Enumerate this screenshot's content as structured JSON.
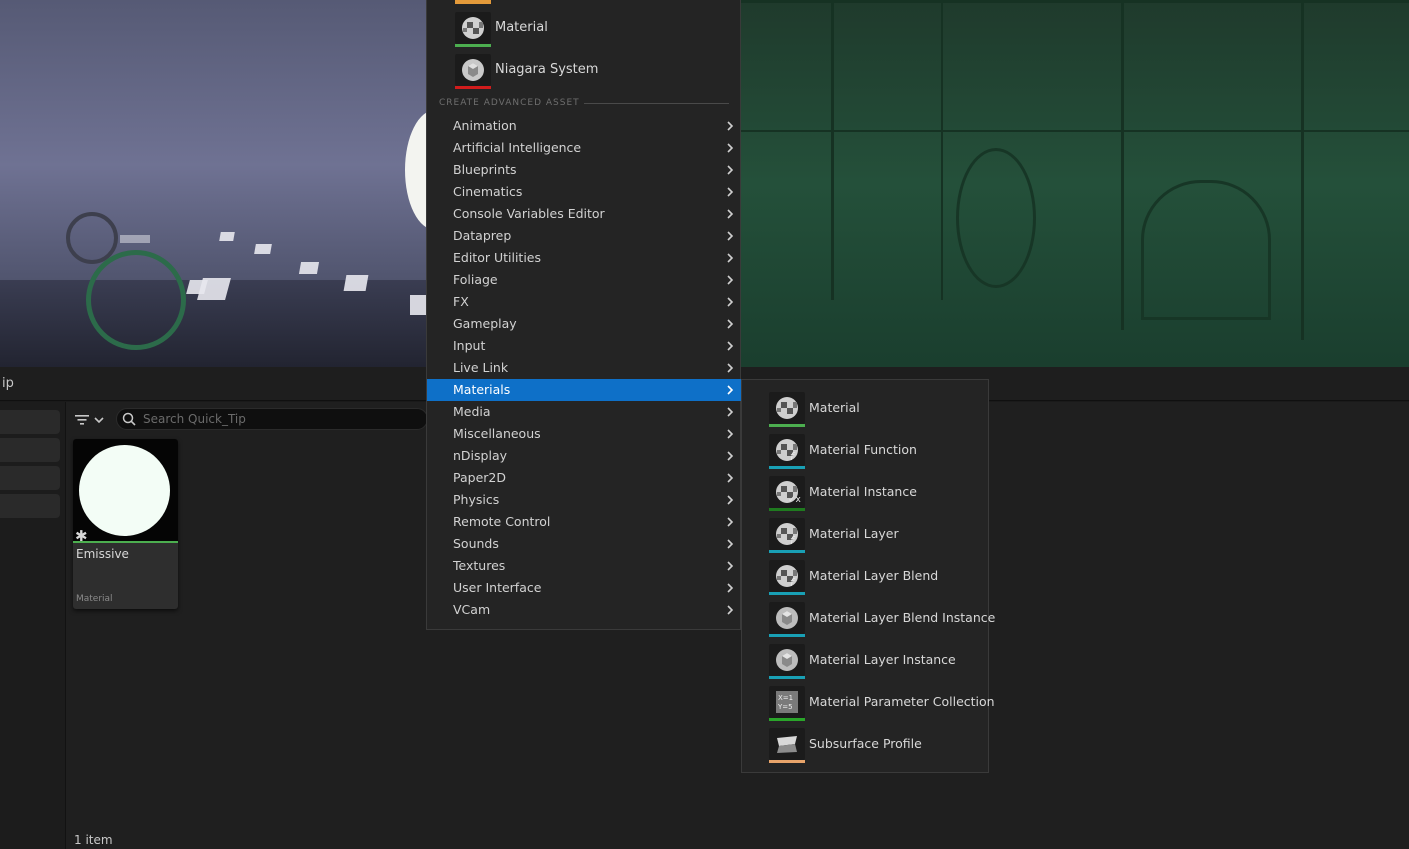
{
  "viewport": {
    "description_colors": {
      "left": "#5a5d78",
      "right": "#24503a"
    }
  },
  "tab": {
    "label": "ip"
  },
  "favorites": [
    {
      "label": "Material",
      "icon": "material-checker-icon",
      "color": "#4cae4f"
    },
    {
      "label": "Niagara System",
      "icon": "niagara-sphere-icon",
      "color": "#d01c1c"
    }
  ],
  "section_header": "CREATE ADVANCED ASSET",
  "categories": [
    "Animation",
    "Artificial Intelligence",
    "Blueprints",
    "Cinematics",
    "Console Variables Editor",
    "Dataprep",
    "Editor Utilities",
    "Foliage",
    "FX",
    "Gameplay",
    "Input",
    "Live Link",
    "Materials",
    "Media",
    "Miscellaneous",
    "nDisplay",
    "Paper2D",
    "Physics",
    "Remote Control",
    "Sounds",
    "Textures",
    "User Interface",
    "VCam"
  ],
  "active_category": "Materials",
  "submenu": [
    {
      "label": "Material",
      "icon": "material-checker-icon",
      "color": "#4cae4f"
    },
    {
      "label": "Material Function",
      "icon": "material-function-icon",
      "color": "#19a0b5"
    },
    {
      "label": "Material Instance",
      "icon": "material-instance-icon",
      "color": "#1f7a1f"
    },
    {
      "label": "Material Layer",
      "icon": "material-layer-icon",
      "color": "#19a0b5"
    },
    {
      "label": "Material Layer Blend",
      "icon": "material-layer-blend-icon",
      "color": "#19a0b5"
    },
    {
      "label": "Material Layer Blend Instance",
      "icon": "sphere-icon",
      "color": "#19a0b5"
    },
    {
      "label": "Material Layer Instance",
      "icon": "sphere-icon",
      "color": "#19a0b5"
    },
    {
      "label": "Material Parameter Collection",
      "icon": "parameter-collection-icon",
      "color": "#2aa52a"
    },
    {
      "label": "Subsurface Profile",
      "icon": "subsurface-profile-icon",
      "color": "#e8a46a"
    }
  ],
  "content_browser": {
    "search_placeholder": "Search Quick_Tip",
    "asset": {
      "name": "Emissive",
      "type": "Material"
    },
    "item_count": "1 item"
  }
}
